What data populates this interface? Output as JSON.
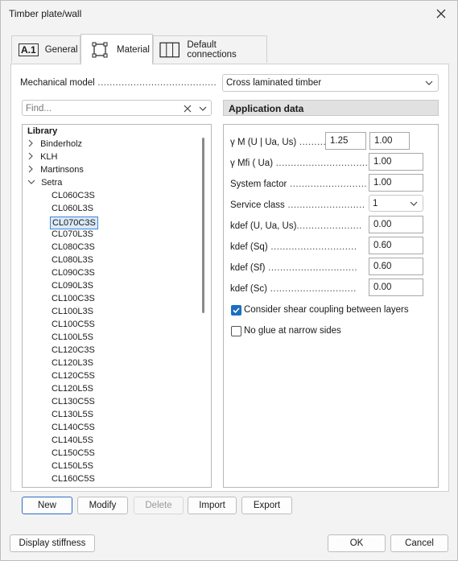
{
  "window": {
    "title": "Timber plate/wall"
  },
  "tabs": [
    {
      "id": "general",
      "icon_text": "A.1",
      "label": "General"
    },
    {
      "id": "material",
      "label": "Material"
    },
    {
      "id": "default_connections",
      "label": "Default connections"
    }
  ],
  "material": {
    "mechanical_model": {
      "label": "Mechanical model",
      "value": "Cross laminated timber"
    },
    "search": {
      "placeholder": "Find..."
    },
    "library": {
      "root": "Library",
      "groups": [
        "Binderholz",
        "KLH",
        "Martinsons",
        "Setra"
      ],
      "expanded_group": "Setra",
      "selected": "CL070C3S",
      "items": [
        "CL060C3S",
        "CL060L3S",
        "CL070C3S",
        "CL070L3S",
        "CL080C3S",
        "CL080L3S",
        "CL090C3S",
        "CL090L3S",
        "CL100C3S",
        "CL100L3S",
        "CL100C5S",
        "CL100L5S",
        "CL120C3S",
        "CL120L3S",
        "CL120C5S",
        "CL120L5S",
        "CL130C5S",
        "CL130L5S",
        "CL140C5S",
        "CL140L5S",
        "CL150C5S",
        "CL150L5S",
        "CL160C5S"
      ]
    },
    "application_data": {
      "header": "Application data",
      "gamma_m": {
        "label": "γ M (U | Ua, Us)",
        "value1": "1.25",
        "value2": "1.00"
      },
      "gamma_mfi": {
        "label": "γ Mfi ( Ua)",
        "value": "1.00"
      },
      "system_factor": {
        "label": "System factor",
        "value": "1.00"
      },
      "service_class": {
        "label": "Service class",
        "value": "1"
      },
      "kdef_u": {
        "label": "kdef (U, Ua, Us)",
        "value": "0.00"
      },
      "kdef_sq": {
        "label": "kdef (Sq)",
        "value": "0.60"
      },
      "kdef_sf": {
        "label": "kdef (Sf)",
        "value": "0.60"
      },
      "kdef_sc": {
        "label": "kdef (Sc)",
        "value": "0.00"
      },
      "shear_coupling": {
        "label": "Consider shear coupling between layers",
        "checked": true
      },
      "no_glue": {
        "label": "No glue at narrow sides",
        "checked": false
      }
    },
    "buttons": {
      "new": "New",
      "modify": "Modify",
      "delete": "Delete",
      "import": "Import",
      "export": "Export"
    }
  },
  "footer": {
    "display_stiffness": "Display stiffness",
    "ok": "OK",
    "cancel": "Cancel"
  },
  "colors": {
    "accent": "#1a6fc0",
    "selection_bg": "#dbe9f8",
    "selection_border": "#3d86d6"
  }
}
